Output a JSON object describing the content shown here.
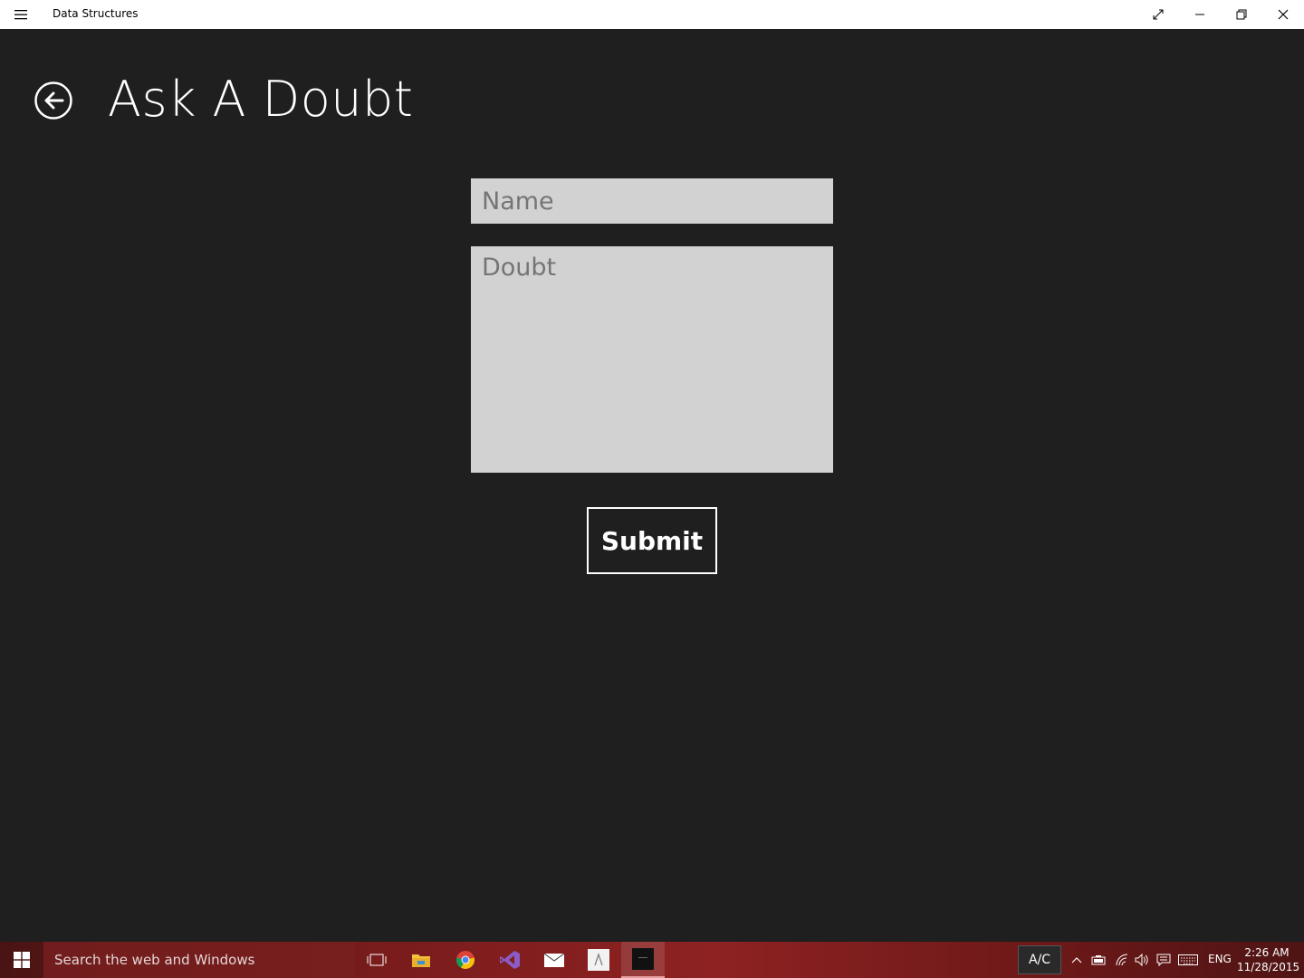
{
  "window": {
    "title": "Data Structures",
    "icons": [
      "hamburger-menu-icon",
      "fullscreen-icon",
      "minimize-icon",
      "restore-icon",
      "close-icon"
    ]
  },
  "page": {
    "title": "Ask A Doubt",
    "back_icon": "back-arrow-icon"
  },
  "form": {
    "name_placeholder": "Name",
    "doubt_placeholder": "Doubt",
    "submit_label": "Submit"
  },
  "taskbar": {
    "search_placeholder": "Search the web and Windows",
    "apps": [
      "task-view-icon",
      "file-explorer-icon",
      "chrome-icon",
      "visual-studio-icon",
      "mail-icon",
      "app-icon",
      "data-structures-app-icon"
    ],
    "ac_label": "A/C",
    "language": "ENG",
    "time": "2:26 AM",
    "date": "11/28/2015"
  },
  "colors": {
    "background": "#1f1f1f",
    "field": "#d2d2d2",
    "text": "#ffffff"
  }
}
